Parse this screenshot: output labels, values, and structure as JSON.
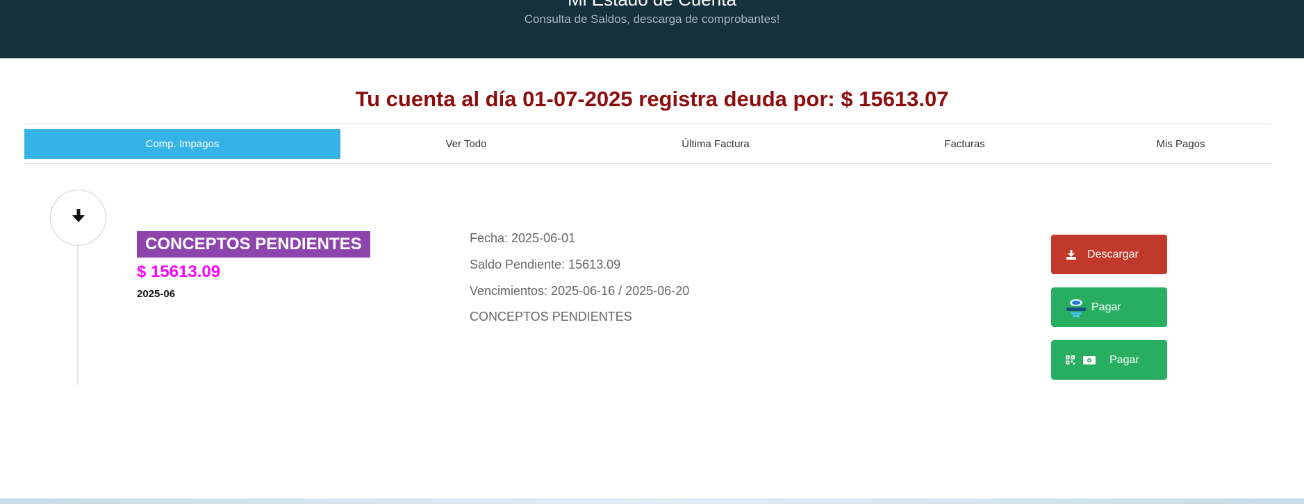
{
  "header": {
    "title": "Mi Estado de Cuenta",
    "subtitle": "Consulta de Saldos, descarga de comprobantes!"
  },
  "debt_banner": "Tu cuenta al día 01-07-2025 registra deuda por: $ 15613.07",
  "tabs": [
    {
      "label": "Comp. Impagos",
      "active": true
    },
    {
      "label": "Ver Todo",
      "active": false
    },
    {
      "label": "Última Factura",
      "active": false
    },
    {
      "label": "Facturas",
      "active": false
    },
    {
      "label": "Mis Pagos",
      "active": false
    }
  ],
  "item": {
    "concept": "CONCEPTOS PENDIENTES",
    "amount": "$ 15613.09",
    "period": "2025-06",
    "details": {
      "fecha": "Fecha: 2025-06-01",
      "saldo": "Saldo Pendiente: 15613.09",
      "vencimientos": "Vencimientos: 2025-06-16 / 2025-06-20",
      "concepto": "CONCEPTOS PENDIENTES"
    },
    "actions": {
      "download_label": "Descargar",
      "pay_mp_label": "Pagar",
      "pay_qr_label": "Pagar"
    }
  },
  "icons": {
    "timeline": "arrow-down-icon",
    "download": "download-icon",
    "mercadopago": "mercadopago-logo",
    "qr": "qr-code-icon",
    "cash": "money-bill-icon"
  },
  "colors": {
    "header_bg": "#15313d",
    "debt_text": "#8b0d0d",
    "active_tab": "#36b3e6",
    "concept_badge": "#8e44ad",
    "amount": "#ff00ff",
    "download_button": "#c0392b",
    "pay_button": "#27ae60"
  }
}
